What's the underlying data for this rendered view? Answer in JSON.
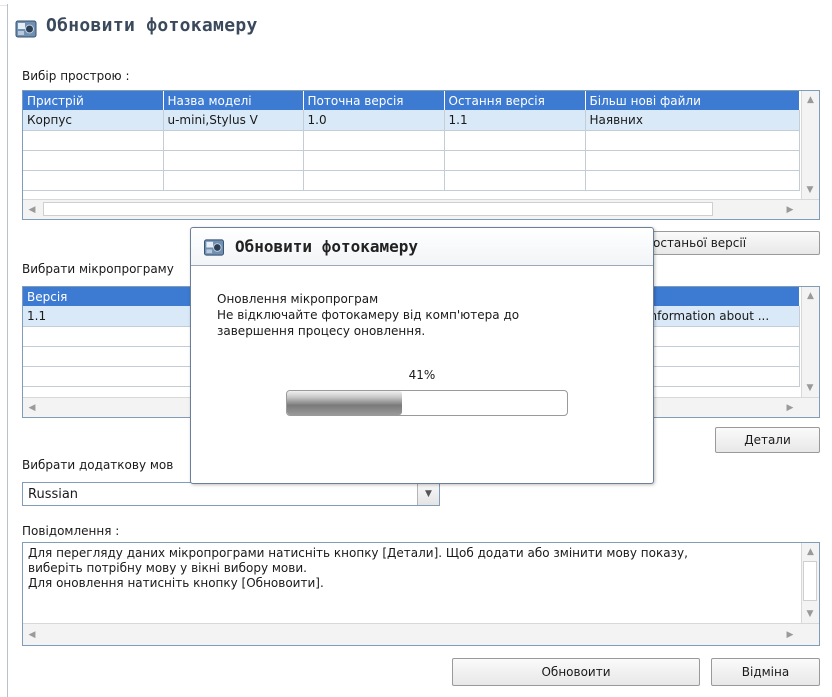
{
  "window": {
    "title": "Обновити фотокамеру"
  },
  "device_section": {
    "label": "Вибір прострою :",
    "columns": [
      "Пристрій",
      "Назва моделі",
      "Поточна версія",
      "Остання версія",
      "Більш нові файли"
    ],
    "rows": [
      [
        "Корпус",
        "u-mini,Stylus V",
        "1.0",
        "1.1",
        "Наявних"
      ],
      [
        "",
        "",
        "",
        "",
        ""
      ],
      [
        "",
        "",
        "",
        "",
        ""
      ],
      [
        "",
        "",
        "",
        "",
        ""
      ]
    ]
  },
  "latest_button_label": "останьої версії",
  "firmware_section": {
    "label": "Вибрати мікропрограму",
    "columns": [
      "Версія"
    ],
    "rows": [
      [
        "1.1"
      ],
      [
        ""
      ],
      [
        ""
      ],
      [
        ""
      ]
    ],
    "info_text": "e information about ..."
  },
  "details_button_label": "Детали",
  "language_section": {
    "label": "Вибрати додаткову мов",
    "selected": "Russian"
  },
  "messages": {
    "label": "Повідомлення :",
    "lines": [
      "Для перегляду даних мікропрограми натисніть кнопку [Детали]. Щоб додати або змінити мову показу,",
      "виберіть потрібну мову у вікні вибору мови.",
      "Для оновлення натисніть кнопку [Обновоити]."
    ]
  },
  "update_button_label": "Обновоити",
  "cancel_button_label": "Відміна",
  "progress_dialog": {
    "title": "Обновити фотокамеру",
    "line1": "Оновлення мікропрограм",
    "line2": "Не відключайте фотокамеру від комп'ютера до",
    "line3": "завершення процесу оновлення.",
    "percent_text": "41%",
    "progress": 0.41
  },
  "colors": {
    "header_blue": "#3d7bd2",
    "selected_row": "#d9e9f8",
    "border": "#7f9db9"
  }
}
